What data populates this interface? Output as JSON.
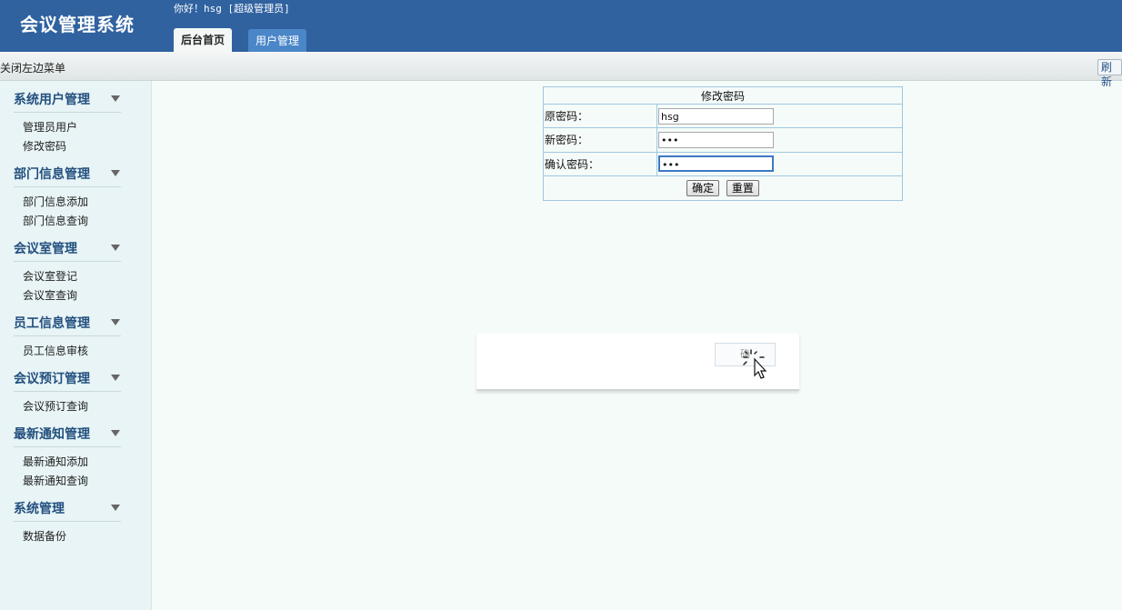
{
  "header": {
    "logo": "会议管理系统",
    "greeting": "你好！hsg [超级管理员]",
    "tabs": [
      "后台首页",
      "用户管理"
    ]
  },
  "toolbar": {
    "close_menu": "关闭左边菜单",
    "refresh": "刷新"
  },
  "sidebar": {
    "sections": [
      {
        "title": "系统用户管理",
        "items": [
          "管理员用户",
          "修改密码"
        ]
      },
      {
        "title": "部门信息管理",
        "items": [
          "部门信息添加",
          "部门信息查询"
        ]
      },
      {
        "title": "会议室管理",
        "items": [
          "会议室登记",
          "会议室查询"
        ]
      },
      {
        "title": "员工信息管理",
        "items": [
          "员工信息审核"
        ]
      },
      {
        "title": "会议预订管理",
        "items": [
          "会议预订查询"
        ]
      },
      {
        "title": "最新通知管理",
        "items": [
          "最新通知添加",
          "最新通知查询"
        ]
      },
      {
        "title": "系统管理",
        "items": [
          "数据备份"
        ]
      }
    ]
  },
  "form": {
    "title": "修改密码",
    "old_label": "原密码：",
    "old_value": "hsg",
    "new_label": "新密码：",
    "new_value": "•••",
    "confirm_label": "确认密码：",
    "confirm_value": "•••",
    "submit": "确定",
    "reset": "重置"
  },
  "dialog": {
    "button_label": "确"
  },
  "colors": {
    "header_bg": "#3062a0",
    "sidebar_bg": "#e8f4f5",
    "content_bg": "#f5fbf9",
    "section_title": "#23507f"
  }
}
